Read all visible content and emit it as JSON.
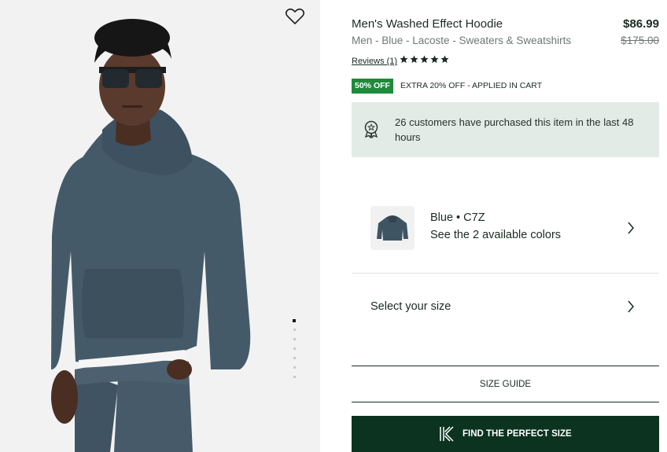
{
  "product": {
    "title": "Men's Washed Effect Hoodie",
    "breadcrumb": "Men - Blue - Lacoste - Sweaters & Sweatshirts",
    "price": "$86.99",
    "original_price": "$175.00",
    "reviews_label": "Reviews (1)",
    "rating": 5,
    "rating_max": 5
  },
  "promo": {
    "badge": "50% OFF",
    "extra": "EXTRA 20% OFF - APPLIED IN CART",
    "badge_color": "#1e8a3a"
  },
  "social_proof": {
    "text": "26 customers have purchased this item in the last 48 hours",
    "icon": "ribbon-badge-icon"
  },
  "color_selector": {
    "color": "Blue • C7Z",
    "available": "See the 2 available colors"
  },
  "size_selector": {
    "label": "Select your size"
  },
  "size_guide": {
    "label": "SIZE GUIDE"
  },
  "fit_button": {
    "label": "FIND THE PERFECT SIZE",
    "background": "#0b3320"
  },
  "gallery": {
    "image_count": 7,
    "active_index": 0
  }
}
